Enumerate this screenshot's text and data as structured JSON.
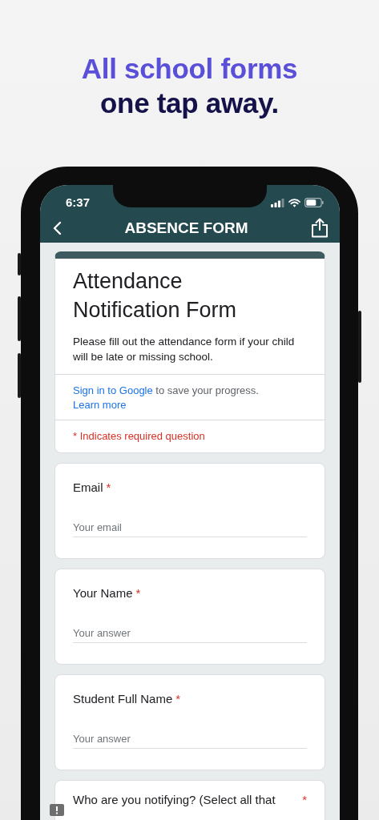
{
  "headline": {
    "line_1": "All school forms",
    "line_2": "one tap away."
  },
  "status_bar": {
    "time": "6:37"
  },
  "nav": {
    "title": "ABSENCE FORM"
  },
  "form": {
    "title": "Attendance Notification Form",
    "description": "Please fill out the attendance form if your child will be late or missing school.",
    "sign_in_link": "Sign in to Google",
    "sign_in_text": " to save your progress.",
    "learn_more": "Learn more",
    "required_note": "* Indicates required question"
  },
  "questions": [
    {
      "label": "Email",
      "required_mark": "*",
      "placeholder": "Your email"
    },
    {
      "label": "Your Name",
      "required_mark": "*",
      "placeholder": "Your answer"
    },
    {
      "label": "Student Full Name",
      "required_mark": "*",
      "placeholder": "Your answer"
    },
    {
      "label": "Who are you notifying? (Select all that",
      "required_mark": "*"
    }
  ]
}
